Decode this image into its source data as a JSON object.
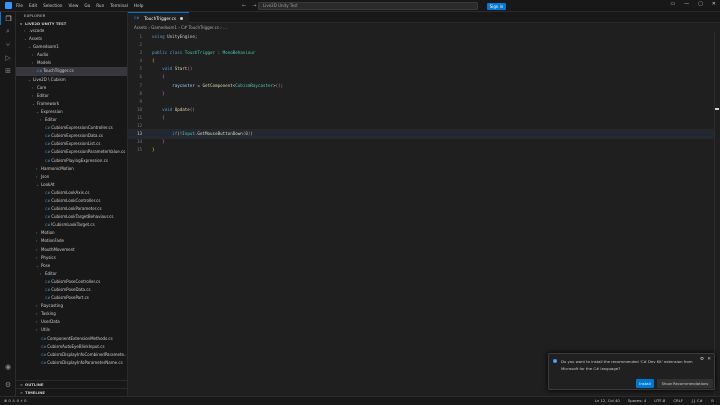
{
  "titlebar": {
    "menu": [
      "File",
      "Edit",
      "Selection",
      "View",
      "Go",
      "Run",
      "Terminal",
      "Help"
    ],
    "nav_back": "←",
    "nav_forward": "→",
    "search": "Live2D Unity Test",
    "signin": "Sign in"
  },
  "activity": [
    "files-icon",
    "search-icon",
    "source-control-icon",
    "run-debug-icon",
    "extensions-icon",
    "accounts-icon",
    "manage-icon"
  ],
  "sidebar": {
    "header": "EXPLORER",
    "root": "LIVE2D UNITY TEST",
    "items": [
      {
        "label": ".vscode",
        "depth": 1,
        "tw": ">",
        "cs": false,
        "sel": false
      },
      {
        "label": "Assets",
        "depth": 1,
        "tw": "v",
        "cs": false,
        "sel": false
      },
      {
        "label": "Gamedoom1",
        "depth": 2,
        "tw": "v",
        "cs": false,
        "sel": false
      },
      {
        "label": "Audio",
        "depth": 3,
        "tw": ">",
        "cs": false,
        "sel": false
      },
      {
        "label": "Models",
        "depth": 3,
        "tw": ">",
        "cs": false,
        "sel": false
      },
      {
        "label": "TouchTrigger.cs",
        "depth": 3,
        "tw": "",
        "cs": true,
        "sel": true
      },
      {
        "label": "Live2D \\ Cubism",
        "depth": 2,
        "tw": "v",
        "cs": false,
        "sel": false
      },
      {
        "label": "Core",
        "depth": 3,
        "tw": ">",
        "cs": false,
        "sel": false
      },
      {
        "label": "Editor",
        "depth": 3,
        "tw": ">",
        "cs": false,
        "sel": false
      },
      {
        "label": "Framework",
        "depth": 3,
        "tw": "v",
        "cs": false,
        "sel": false
      },
      {
        "label": "Expression",
        "depth": 4,
        "tw": "v",
        "cs": false,
        "sel": false
      },
      {
        "label": "Editor",
        "depth": 5,
        "tw": ">",
        "cs": false,
        "sel": false
      },
      {
        "label": "CubismExpressionController.cs",
        "depth": 5,
        "tw": "",
        "cs": true,
        "sel": false
      },
      {
        "label": "CubismExpressionData.cs",
        "depth": 5,
        "tw": "",
        "cs": true,
        "sel": false
      },
      {
        "label": "CubismExpressionList.cs",
        "depth": 5,
        "tw": "",
        "cs": true,
        "sel": false
      },
      {
        "label": "CubismExpressionParameterValue.cs",
        "depth": 5,
        "tw": "",
        "cs": true,
        "sel": false
      },
      {
        "label": "CubismPlayingExpression.cs",
        "depth": 5,
        "tw": "",
        "cs": true,
        "sel": false
      },
      {
        "label": "HarmonicMotion",
        "depth": 4,
        "tw": ">",
        "cs": false,
        "sel": false
      },
      {
        "label": "Json",
        "depth": 4,
        "tw": ">",
        "cs": false,
        "sel": false
      },
      {
        "label": "LookAt",
        "depth": 4,
        "tw": "v",
        "cs": false,
        "sel": false
      },
      {
        "label": "CubismLookAxis.cs",
        "depth": 5,
        "tw": "",
        "cs": true,
        "sel": false
      },
      {
        "label": "CubismLookController.cs",
        "depth": 5,
        "tw": "",
        "cs": true,
        "sel": false
      },
      {
        "label": "CubismLookParameter.cs",
        "depth": 5,
        "tw": "",
        "cs": true,
        "sel": false
      },
      {
        "label": "CubismLookTargetBehaviour.cs",
        "depth": 5,
        "tw": "",
        "cs": true,
        "sel": false
      },
      {
        "label": "ICubismLookTarget.cs",
        "depth": 5,
        "tw": "",
        "cs": true,
        "sel": false
      },
      {
        "label": "Motion",
        "depth": 4,
        "tw": ">",
        "cs": false,
        "sel": false
      },
      {
        "label": "MotionFade",
        "depth": 4,
        "tw": ">",
        "cs": false,
        "sel": false
      },
      {
        "label": "MouthMovement",
        "depth": 4,
        "tw": ">",
        "cs": false,
        "sel": false
      },
      {
        "label": "Physics",
        "depth": 4,
        "tw": ">",
        "cs": false,
        "sel": false
      },
      {
        "label": "Pose",
        "depth": 4,
        "tw": "v",
        "cs": false,
        "sel": false
      },
      {
        "label": "Editor",
        "depth": 5,
        "tw": ">",
        "cs": false,
        "sel": false
      },
      {
        "label": "CubismPoseController.cs",
        "depth": 5,
        "tw": "",
        "cs": true,
        "sel": false
      },
      {
        "label": "CubismPoseData.cs",
        "depth": 5,
        "tw": "",
        "cs": true,
        "sel": false
      },
      {
        "label": "CubismPosePart.cs",
        "depth": 5,
        "tw": "",
        "cs": true,
        "sel": false
      },
      {
        "label": "Raycasting",
        "depth": 4,
        "tw": ">",
        "cs": false,
        "sel": false
      },
      {
        "label": "Tasking",
        "depth": 4,
        "tw": ">",
        "cs": false,
        "sel": false
      },
      {
        "label": "UserData",
        "depth": 4,
        "tw": ">",
        "cs": false,
        "sel": false
      },
      {
        "label": "Utils",
        "depth": 4,
        "tw": ">",
        "cs": false,
        "sel": false
      },
      {
        "label": "ComponentExtensionMethods.cs",
        "depth": 4,
        "tw": "",
        "cs": true,
        "sel": false
      },
      {
        "label": "CubismAutoEyeBlinkInput.cs",
        "depth": 4,
        "tw": "",
        "cs": true,
        "sel": false
      },
      {
        "label": "CubismDisplayInfoCombinedParamete...",
        "depth": 4,
        "tw": "",
        "cs": true,
        "sel": false
      },
      {
        "label": "CubismDisplayInfoParameterName.cs",
        "depth": 4,
        "tw": "",
        "cs": true,
        "sel": false
      }
    ],
    "outline": "OUTLINE",
    "timeline": "TIMELINE"
  },
  "editor": {
    "tab": "TouchTrigger.cs",
    "breadcrumb": "Assets › Gamedoom1 › C# TouchTrigger.cs › ...",
    "lines": [
      {
        "n": "1",
        "cur": false,
        "tokens": [
          [
            "k",
            "using "
          ],
          [
            "p",
            "UnityEngine;"
          ]
        ]
      },
      {
        "n": "2",
        "cur": false,
        "tokens": []
      },
      {
        "n": "3",
        "cur": false,
        "tokens": [
          [
            "k",
            "public class "
          ],
          [
            "t",
            "TouchTrigger"
          ],
          [
            "p",
            " : "
          ],
          [
            "t",
            "MonoBehaviour"
          ]
        ]
      },
      {
        "n": "4",
        "cur": false,
        "tokens": [
          [
            "y",
            "{"
          ]
        ]
      },
      {
        "n": "5",
        "cur": false,
        "tokens": [
          [
            "p",
            "    "
          ],
          [
            "k",
            "void "
          ],
          [
            "f",
            "Start"
          ],
          [
            "pu",
            "()"
          ]
        ]
      },
      {
        "n": "6",
        "cur": false,
        "tokens": [
          [
            "p",
            "    "
          ],
          [
            "pu",
            "{"
          ]
        ]
      },
      {
        "n": "7",
        "cur": false,
        "tokens": [
          [
            "p",
            "        "
          ],
          [
            "v",
            "raycaster"
          ],
          [
            "p",
            " = "
          ],
          [
            "f",
            "GetComponent"
          ],
          [
            "p",
            "<"
          ],
          [
            "t",
            "CubismRaycaster"
          ],
          [
            "p",
            ">"
          ],
          [
            "pu",
            "()"
          ],
          [
            "p",
            ";"
          ]
        ]
      },
      {
        "n": "8",
        "cur": false,
        "tokens": [
          [
            "p",
            "    "
          ],
          [
            "pu",
            "}"
          ]
        ]
      },
      {
        "n": "9",
        "cur": false,
        "tokens": []
      },
      {
        "n": "10",
        "cur": false,
        "tokens": [
          [
            "p",
            "    "
          ],
          [
            "k",
            "void "
          ],
          [
            "f",
            "Update"
          ],
          [
            "pu",
            "()"
          ]
        ]
      },
      {
        "n": "11",
        "cur": false,
        "tokens": [
          [
            "p",
            "    "
          ],
          [
            "pu",
            "{"
          ]
        ]
      },
      {
        "n": "12",
        "cur": false,
        "tokens": []
      },
      {
        "n": "13",
        "cur": true,
        "tokens": [
          [
            "p",
            "        "
          ],
          [
            "k",
            "if"
          ],
          [
            "y",
            "("
          ],
          [
            "p",
            "!"
          ],
          [
            "t",
            "Input"
          ],
          [
            "p",
            "."
          ],
          [
            "f",
            "GetMouseButtonDown"
          ],
          [
            "pu",
            "("
          ],
          [
            "n",
            "0"
          ],
          [
            "pu",
            ")"
          ],
          [
            "y",
            ")"
          ]
        ]
      },
      {
        "n": "14",
        "cur": false,
        "tokens": [
          [
            "p",
            "    "
          ],
          [
            "pu",
            "}"
          ]
        ]
      },
      {
        "n": "15",
        "cur": false,
        "tokens": [
          [
            "y",
            "}"
          ]
        ]
      }
    ]
  },
  "toast": {
    "message": "Do you want to install the recommended 'C# Dev Kit' extension from Microsoft for the C# language?",
    "install": "Install",
    "show": "Show Recommendations"
  },
  "status": {
    "left": "⊗ 0  ⚠ 0   ⚡ 0",
    "right": [
      "Ln 12, Col 40",
      "Spaces: 4",
      "UTF-8",
      "CRLF",
      "{} C#",
      "⊙"
    ]
  }
}
